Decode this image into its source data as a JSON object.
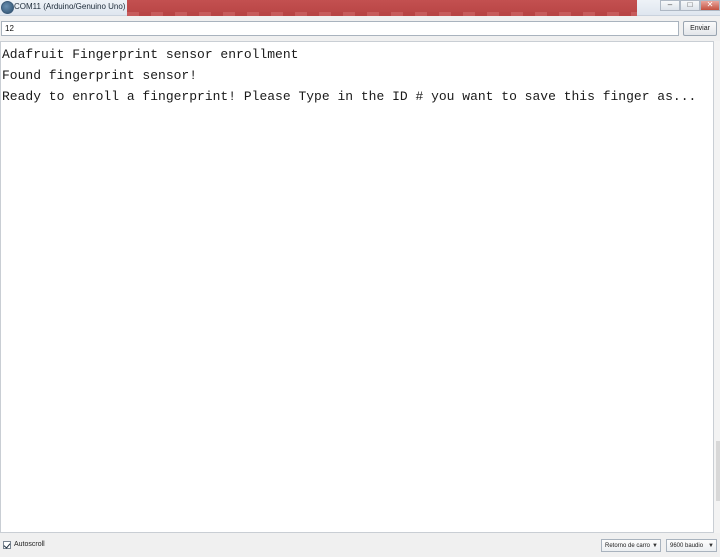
{
  "window": {
    "title": "COM11 (Arduino/Genuino Uno)",
    "icon": "arduino-app-icon",
    "controls": {
      "minimize": "–",
      "maximize": "□",
      "close": "✕"
    }
  },
  "input": {
    "value": "12",
    "send_label": "Enviar"
  },
  "output": {
    "lines": [
      "Adafruit Fingerprint sensor enrollment",
      "Found fingerprint sensor!",
      "Ready to enroll a fingerprint! Please Type in the ID # you want to save this finger as..."
    ]
  },
  "footer": {
    "autoscroll_label": "Autoscroll",
    "autoscroll_checked": true,
    "line_ending": "Retorno de carro",
    "baud_rate": "9600 baudio"
  },
  "colors": {
    "accent_band": "#b84444",
    "background": "#ffffff"
  }
}
